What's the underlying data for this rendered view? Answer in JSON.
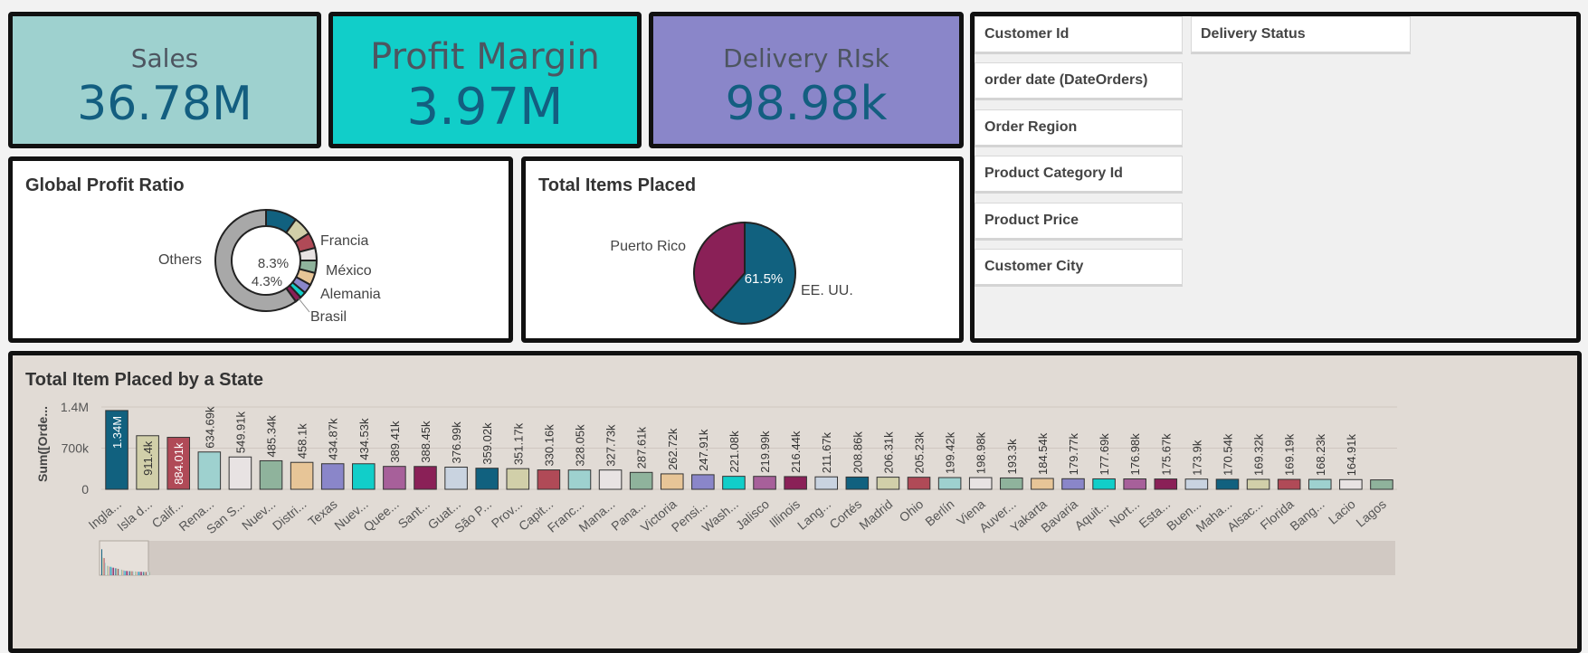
{
  "kpis": {
    "sales": {
      "label": "Sales",
      "value": "36.78M",
      "color": "#9ed1cf"
    },
    "profit_margin": {
      "label": "Profit Margin",
      "value": "3.97M",
      "color": "#11cec9"
    },
    "delivery_risk": {
      "label": "Delivery RIsk",
      "value": "98.98k",
      "color": "#8a86c9"
    }
  },
  "filters": [
    "Customer Id",
    "Delivery Status",
    "order date (DateOrders)",
    "Order Region",
    "Product Category Id",
    "Product Price",
    "Customer City"
  ],
  "chart_data": [
    {
      "type": "pie",
      "title": "Global Profit Ratio",
      "donut": true,
      "center_labels": [
        "8.3%",
        "4.3%"
      ],
      "labels": [
        "Francia",
        "México",
        "Alemania",
        "Brasil",
        "Others"
      ],
      "slices": [
        {
          "name": "",
          "value": 10,
          "color": "#11617f"
        },
        {
          "name": "Francia",
          "value": 6,
          "color": "#d1cfa9"
        },
        {
          "name": "México",
          "value": 5,
          "color": "#b04a57"
        },
        {
          "name": "Alemania",
          "value": 4,
          "color": "#e8e3e3"
        },
        {
          "name": "",
          "value": 4,
          "color": "#8fb39c"
        },
        {
          "name": "Brasil",
          "value": 4,
          "color": "#e7c597"
        },
        {
          "name": "",
          "value": 3,
          "color": "#8a86c9"
        },
        {
          "name": "",
          "value": 2,
          "color": "#11cec9"
        },
        {
          "name": "",
          "value": 2,
          "color": "#8a2057"
        },
        {
          "name": "Others",
          "value": 60,
          "color": "#a8a8a8"
        }
      ]
    },
    {
      "type": "pie",
      "title": "Total Items Placed",
      "slices": [
        {
          "name": "EE. UU.",
          "value": 61.5,
          "label": "61.5%",
          "color": "#11617f"
        },
        {
          "name": "Puerto Rico",
          "value": 38.5,
          "color": "#8a2057"
        }
      ]
    },
    {
      "type": "bar",
      "title": "Total Item Placed by a State",
      "ylabel": "Sum([Orde...",
      "ylim": [
        0,
        1400000
      ],
      "yticks": [
        {
          "v": 0,
          "label": "0"
        },
        {
          "v": 700000,
          "label": "700k"
        },
        {
          "v": 1400000,
          "label": "1.4M"
        }
      ],
      "grid": true,
      "categories": [
        "Ingla...",
        "Isla d...",
        "Calif...",
        "Rena...",
        "San S...",
        "Nuev...",
        "Distri...",
        "Texas",
        "Nuev...",
        "Quee...",
        "Sant...",
        "Guat...",
        "São P...",
        "Prov...",
        "Capit...",
        "Franc...",
        "Mana...",
        "Pana...",
        "Victoria",
        "Pensi...",
        "Wash...",
        "Jalisco",
        "Illinois",
        "Lang...",
        "Cortés",
        "Madrid",
        "Ohio",
        "Berlín",
        "Viena",
        "Auver...",
        "Yakarta",
        "Bavaria",
        "Aquit...",
        "Nort...",
        "Esta...",
        "Buen...",
        "Maha...",
        "Alsac...",
        "Florida",
        "Bang...",
        "Lacio",
        "Lagos"
      ],
      "values": [
        1340000,
        911400,
        884010,
        634690,
        549910,
        485340,
        458100,
        434870,
        434530,
        389410,
        388450,
        376990,
        359020,
        351170,
        330160,
        328050,
        327730,
        287610,
        262720,
        247910,
        221080,
        219990,
        216440,
        211670,
        208860,
        206310,
        205230,
        199420,
        198980,
        193300,
        184540,
        179770,
        177690,
        176980,
        175670,
        173900,
        170540,
        169320,
        169190,
        168230,
        164910,
        160000
      ],
      "data_labels": [
        "1.34M",
        "911.4k",
        "884.01k",
        "634.69k",
        "549.91k",
        "485.34k",
        "458.1k",
        "434.87k",
        "434.53k",
        "389.41k",
        "388.45k",
        "376.99k",
        "359.02k",
        "351.17k",
        "330.16k",
        "328.05k",
        "327.73k",
        "287.61k",
        "262.72k",
        "247.91k",
        "221.08k",
        "219.99k",
        "216.44k",
        "211.67k",
        "208.86k",
        "206.31k",
        "205.23k",
        "199.42k",
        "198.98k",
        "193.3k",
        "184.54k",
        "179.77k",
        "177.69k",
        "176.98k",
        "175.67k",
        "173.9k",
        "170.54k",
        "169.32k",
        "169.19k",
        "168.23k",
        "164.91k",
        ""
      ],
      "palette": [
        "#11617f",
        "#d1cfa9",
        "#b04a57",
        "#9ed1cf",
        "#e8e3e3",
        "#8fb39c",
        "#e7c597",
        "#8a86c9",
        "#11cec9",
        "#a7609a",
        "#8a2057",
        "#c9d3e0"
      ]
    }
  ]
}
